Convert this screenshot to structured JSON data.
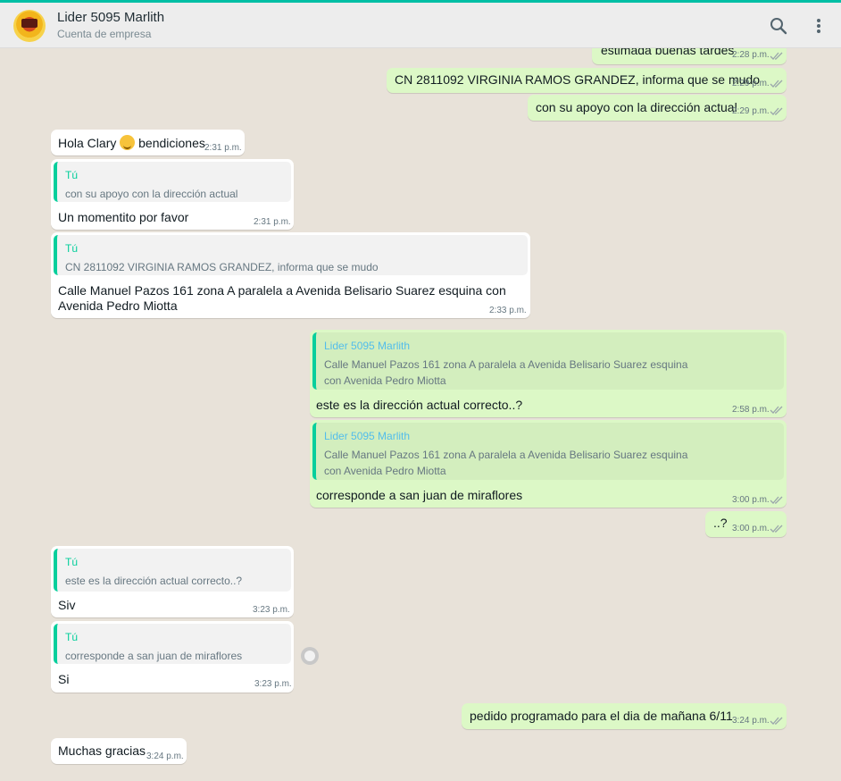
{
  "contact": {
    "name": "Lider 5095 Marlith",
    "subtitle": "Cuenta de empresa"
  },
  "icons": {
    "search": "search-icon",
    "menu": "kebab-menu-icon",
    "ticks": "double-check-icon",
    "emoji": "smiling-face-icon",
    "reaction": "emoji-reaction-icon"
  },
  "colors": {
    "outgoing": "#dcf8c6",
    "incoming": "#ffffff",
    "quote_accent": "#06cf9c",
    "header": "#ededed"
  },
  "messages": [
    {
      "dir": "out",
      "text": "estimada buenas tardes",
      "time": "2:28 p.m."
    },
    {
      "dir": "out",
      "text": "CN 2811092 VIRGINIA RAMOS GRANDEZ, informa que se mudo",
      "time": "2:29 p.m."
    },
    {
      "dir": "out",
      "text": "con su apoyo con la dirección actual",
      "time": "2:29 p.m."
    },
    {
      "dir": "in",
      "text_before": "Hola Clary",
      "text_after": "bendiciones",
      "time": "2:31 p.m."
    },
    {
      "dir": "in",
      "quote_author": "Tú",
      "quote_text": "con su apoyo con la dirección actual",
      "text": "Un momentito por favor",
      "time": "2:31 p.m."
    },
    {
      "dir": "in",
      "quote_author": "Tú",
      "quote_text": "CN 2811092 VIRGINIA RAMOS GRANDEZ, informa que se mudo",
      "text": "Calle Manuel Pazos 161 zona A paralela a Avenida Belisario Suarez esquina con Avenida Pedro Miotta",
      "time": "2:33 p.m."
    },
    {
      "dir": "out",
      "quote_author": "Lider 5095 Marlith",
      "quote_text": "Calle Manuel Pazos 161 zona A paralela a Avenida Belisario Suarez esquina con Avenida Pedro Miotta",
      "text": "este es la dirección actual correcto..?",
      "time": "2:58 p.m."
    },
    {
      "dir": "out",
      "quote_author": "Lider 5095 Marlith",
      "quote_text": "Calle Manuel Pazos 161 zona A paralela a Avenida Belisario Suarez esquina con Avenida Pedro Miotta",
      "text": "corresponde a san juan de miraflores",
      "time": "3:00 p.m."
    },
    {
      "dir": "out",
      "text": "..?",
      "time": "3:00 p.m."
    },
    {
      "dir": "in",
      "quote_author": "Tú",
      "quote_text": "este es la dirección actual correcto..?",
      "text": "Siv",
      "time": "3:23 p.m."
    },
    {
      "dir": "in",
      "quote_author": "Tú",
      "quote_text": "corresponde a san juan de miraflores",
      "text": "Si",
      "time": "3:23 p.m."
    },
    {
      "dir": "out",
      "text": "pedido programado para el dia de mañana 6/11",
      "time": "3:24 p.m."
    },
    {
      "dir": "in",
      "text": "Muchas gracias",
      "time": "3:24 p.m."
    }
  ]
}
